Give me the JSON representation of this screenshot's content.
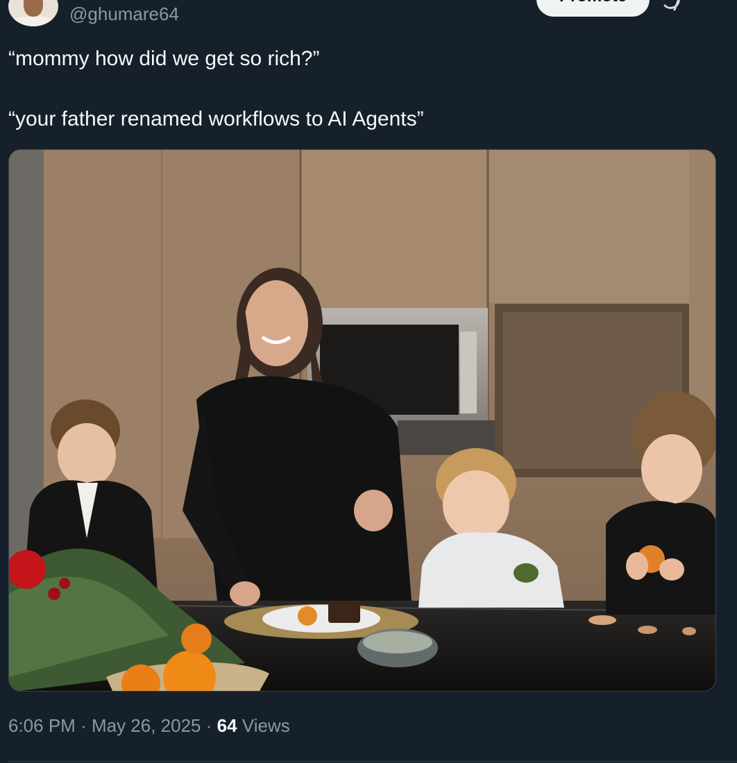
{
  "author": {
    "handle": "@ghumare64"
  },
  "header": {
    "promote_label": "Promote",
    "more_icon": "grok-icon"
  },
  "tweet": {
    "line_one": "“mommy how did we get so rich?”",
    "line_two": "“your father renamed workflows to AI Agents”"
  },
  "media": {
    "alt": "Woman and three children at a kitchen counter with oranges and pine branches"
  },
  "meta": {
    "time": "6:06 PM",
    "separator": "·",
    "date": "May 26, 2025",
    "views_count": "64",
    "views_label": "Views"
  },
  "colors": {
    "background": "#15202b",
    "text": "#f7f9f9",
    "secondary": "#8b98a5",
    "border": "#38444d",
    "button": "#eff3f4"
  }
}
